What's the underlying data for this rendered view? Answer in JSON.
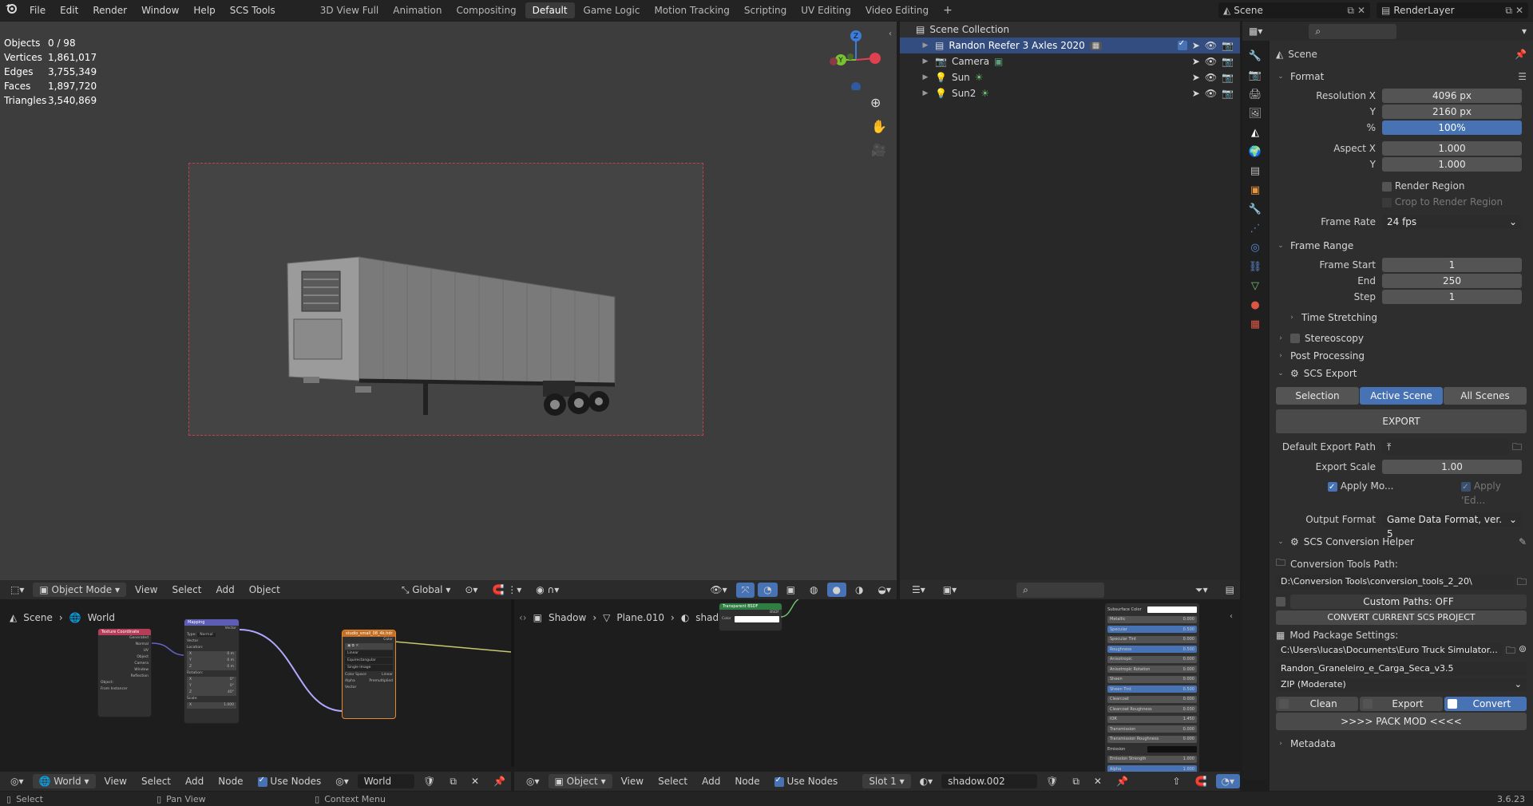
{
  "topbar": {
    "menus": [
      "File",
      "Edit",
      "Render",
      "Window",
      "Help",
      "SCS Tools"
    ],
    "workspaces": [
      "3D View Full",
      "Animation",
      "Compositing",
      "Default",
      "Game Logic",
      "Motion Tracking",
      "Scripting",
      "UV Editing",
      "Video Editing"
    ],
    "active_workspace": "Default",
    "scene": "Scene",
    "view_layer": "RenderLayer"
  },
  "stats": {
    "rows": [
      {
        "label": "Objects",
        "value": "0 / 98"
      },
      {
        "label": "Vertices",
        "value": "1,861,017"
      },
      {
        "label": "Edges",
        "value": "3,755,349"
      },
      {
        "label": "Faces",
        "value": "1,897,720"
      },
      {
        "label": "Triangles",
        "value": "3,540,869"
      }
    ]
  },
  "gizmo": {
    "z": "Z",
    "y": "Y"
  },
  "viewport_header": {
    "mode": "Object Mode",
    "menus": [
      "View",
      "Select",
      "Add",
      "Object"
    ],
    "transform": "Global"
  },
  "outliner": {
    "root": "Scene Collection",
    "items": [
      "Randon Reefer 3 Axles 2020",
      "Camera",
      "Sun",
      "Sun2"
    ]
  },
  "props": {
    "title": "Scene",
    "format": {
      "title": "Format",
      "res_x_label": "Resolution X",
      "res_x": "4096 px",
      "y_label": "Y",
      "res_y": "2160 px",
      "pct_label": "%",
      "pct": "100%",
      "aspect_x_label": "Aspect X",
      "aspect_x": "1.000",
      "aspect_y_label": "Y",
      "aspect_y": "1.000",
      "render_region": "Render Region",
      "crop": "Crop to Render Region",
      "frame_rate_label": "Frame Rate",
      "frame_rate": "24 fps"
    },
    "frame_range": {
      "title": "Frame Range",
      "start_label": "Frame Start",
      "start": "1",
      "end_label": "End",
      "end": "250",
      "step_label": "Step",
      "step": "1",
      "time_stretching": "Time Stretching"
    },
    "stereoscopy": "Stereoscopy",
    "post_processing": "Post Processing",
    "scs_export": {
      "title": "SCS Export",
      "tabs": [
        "Selection",
        "Active Scene",
        "All Scenes"
      ],
      "export_btn": "EXPORT",
      "path_label": "Default Export Path",
      "scale_label": "Export Scale",
      "scale": "1.00",
      "apply_mo": "Apply Mo...",
      "apply_ed": "Apply 'Ed...",
      "format_label": "Output Format",
      "format": "Game Data Format, ver. 5"
    },
    "scs_conv": {
      "title": "SCS Conversion Helper",
      "tools_label": "Conversion Tools Path:",
      "tools_path": "D:\\Conversion Tools\\conversion_tools_2_20\\",
      "custom_paths": "Custom Paths: OFF",
      "convert_current": "CONVERT CURRENT SCS PROJECT",
      "mod_label": "Mod Package Settings:",
      "mod_path": "C:\\Users\\lucas\\Documents\\Euro Truck Simulator...",
      "mod_name": "Randon_Graneleiro_e_Carga_Seca_v3.5",
      "zip": "ZIP (Moderate)",
      "clean": "Clean",
      "export": "Export",
      "convert": "Convert",
      "pack": ">>>>   PACK MOD   <<<<"
    },
    "metadata": "Metadata"
  },
  "node_left": {
    "breadcrumb": [
      "Scene",
      "World"
    ],
    "n1": "Texture Coordinate",
    "n1_rows": [
      "Generated",
      "Normal",
      "UV",
      "Object",
      "Camera",
      "Window",
      "Reflection",
      "Object:",
      "From Instancer"
    ],
    "n2": "Mapping",
    "n2_rows": [
      "Vector",
      "Type:",
      "Normal",
      "Vector",
      "Location:",
      "X",
      "Y",
      "Z",
      "Rotation:",
      "X",
      "Y",
      "Z",
      "Scale:",
      "X",
      "Y",
      "Z"
    ],
    "n2_vals": [
      "0 m",
      "0 m",
      "0 m",
      "0°",
      "0°",
      "40°",
      "1.000",
      "1.000",
      "1.000"
    ],
    "n3": "studio_small_08_4k.hdr",
    "n3_rows": [
      "Color",
      "Linear",
      "Equirectangular",
      "Single Image",
      "Color Space",
      "Linear",
      "Alpha",
      "Premultiplied",
      "Vector"
    ]
  },
  "node_right": {
    "breadcrumb": [
      "Shadow",
      "Plane.010",
      "shadow.002"
    ],
    "n1": "Transparent BSDF",
    "n1_rows": [
      "BSDF",
      "Color"
    ],
    "bsdf": [
      {
        "l": "Subsurface Color",
        "v": ""
      },
      {
        "l": "Metallic",
        "v": "0.000"
      },
      {
        "l": "Specular",
        "v": "0.500"
      },
      {
        "l": "Specular Tint",
        "v": "0.000"
      },
      {
        "l": "Roughness",
        "v": "0.500"
      },
      {
        "l": "Anisotropic",
        "v": "0.000"
      },
      {
        "l": "Anisotropic Rotation",
        "v": "0.000"
      },
      {
        "l": "Sheen",
        "v": "0.000"
      },
      {
        "l": "Sheen Tint",
        "v": "0.500"
      },
      {
        "l": "Clearcoat",
        "v": "0.000"
      },
      {
        "l": "Clearcoat Roughness",
        "v": "0.030"
      },
      {
        "l": "IOR",
        "v": "1.450"
      },
      {
        "l": "Transmission",
        "v": "0.000"
      },
      {
        "l": "Transmission Roughness",
        "v": "0.000"
      },
      {
        "l": "Emission",
        "v": ""
      },
      {
        "l": "Emission Strength",
        "v": "1.000"
      },
      {
        "l": "Alpha",
        "v": "1.000"
      }
    ]
  },
  "bottom_left_header": {
    "type": "World",
    "menus": [
      "View",
      "Select",
      "Add",
      "Node"
    ],
    "use_nodes": "Use Nodes",
    "world": "World"
  },
  "bottom_right_header": {
    "type": "Object",
    "menus": [
      "View",
      "Select",
      "Add",
      "Node"
    ],
    "use_nodes": "Use Nodes",
    "slot": "Slot 1",
    "material": "shadow.002"
  },
  "statusbar": {
    "select": "Select",
    "pan": "Pan View",
    "context": "Context Menu",
    "version": "3.6.23"
  },
  "colors": {
    "accent": "#4772b3",
    "bg": "#1d1d1d",
    "header": "#2b2b2b"
  }
}
